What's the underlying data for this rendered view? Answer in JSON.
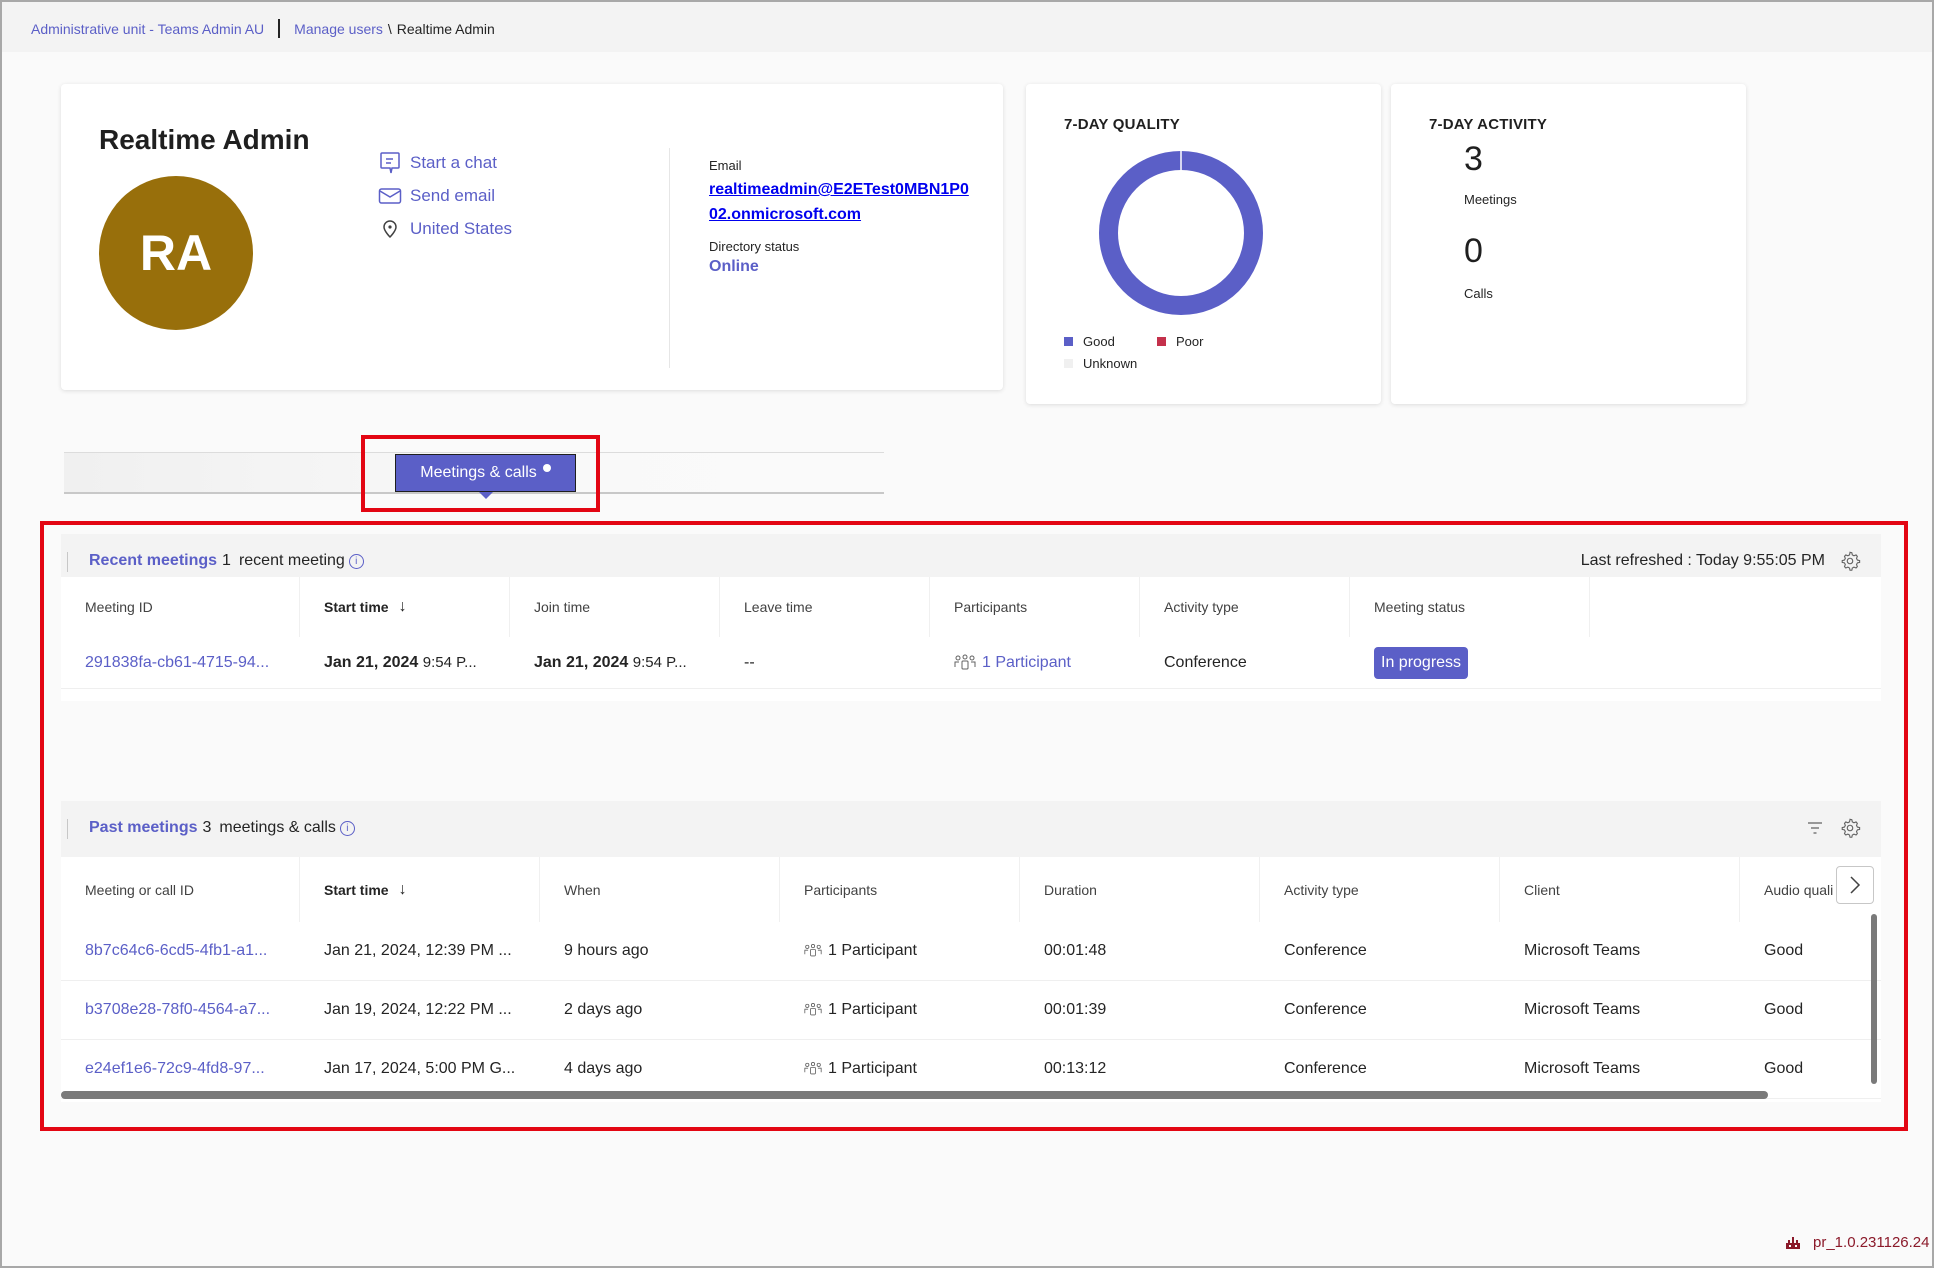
{
  "breadcrumb": {
    "admin_unit": "Administrative unit - Teams Admin AU",
    "manage_users": "Manage users",
    "separator": "\\",
    "current": "Realtime Admin"
  },
  "profile": {
    "name": "Realtime Admin",
    "initials": "RA",
    "avatar_color": "#986f0b",
    "actions": [
      {
        "icon": "chat-icon",
        "label": "Start a chat"
      },
      {
        "icon": "mail-icon",
        "label": "Send email"
      },
      {
        "icon": "location-icon",
        "label": "United States"
      }
    ],
    "email_label": "Email",
    "email": "realtimeadmin@E2ETest0MBN1P002.onmicrosoft.com",
    "directory_status_label": "Directory status",
    "directory_status": "Online"
  },
  "quality": {
    "title": "7-DAY QUALITY",
    "chart_data": {
      "type": "pie",
      "title": "7-DAY QUALITY",
      "categories": [
        "Good",
        "Poor",
        "Unknown"
      ],
      "values": [
        100,
        0,
        0
      ],
      "colors": [
        "#5b5fc7",
        "#c4314b",
        "#f0f0f0"
      ],
      "legend": "bottom"
    },
    "legend": [
      {
        "label": "Good",
        "color": "#5b5fc7"
      },
      {
        "label": "Poor",
        "color": "#c4314b"
      },
      {
        "label": "Unknown",
        "color": "#f0f0f0"
      }
    ]
  },
  "activity": {
    "title": "7-DAY ACTIVITY",
    "meetings_count": "3",
    "meetings_label": "Meetings",
    "calls_count": "0",
    "calls_label": "Calls"
  },
  "tabs": {
    "active": "Meetings & calls"
  },
  "recent": {
    "title": "Recent meetings",
    "count": "1",
    "count_label": "recent meeting",
    "last_refreshed": "Last refreshed : Today 9:55:05 PM",
    "columns": [
      "Meeting ID",
      "Start time",
      "Join time",
      "Leave time",
      "Participants",
      "Activity type",
      "Meeting status"
    ],
    "sort_arrow": "↓",
    "rows": [
      {
        "id": "291838fa-cb61-4715-94...",
        "start_date": "Jan 21, 2024",
        "start_time": "9:54 P...",
        "join_date": "Jan 21, 2024",
        "join_time": "9:54 P...",
        "leave": "--",
        "participants": "1 Participant",
        "activity": "Conference",
        "status": "In progress"
      }
    ]
  },
  "past": {
    "title": "Past meetings",
    "count": "3",
    "count_label": "meetings & calls",
    "columns": [
      "Meeting or call ID",
      "Start time",
      "When",
      "Participants",
      "Duration",
      "Activity type",
      "Client",
      "Audio quali"
    ],
    "sort_arrow": "↓",
    "rows": [
      {
        "id": "8b7c64c6-6cd5-4fb1-a1...",
        "start": "Jan 21, 2024, 12:39 PM ...",
        "when": "9 hours ago",
        "participants": "1 Participant",
        "duration": "00:01:48",
        "activity": "Conference",
        "client": "Microsoft Teams",
        "audio": "Good"
      },
      {
        "id": "b3708e28-78f0-4564-a7...",
        "start": "Jan 19, 2024, 12:22 PM ...",
        "when": "2 days ago",
        "participants": "1 Participant",
        "duration": "00:01:39",
        "activity": "Conference",
        "client": "Microsoft Teams",
        "audio": "Good"
      },
      {
        "id": "e24ef1e6-72c9-4fd8-97...",
        "start": "Jan 17, 2024, 5:00 PM G...",
        "when": "4 days ago",
        "participants": "1 Participant",
        "duration": "00:13:12",
        "activity": "Conference",
        "client": "Microsoft Teams",
        "audio": "Good"
      }
    ]
  },
  "footer": {
    "version": "pr_1.0.231126.24"
  },
  "colors": {
    "accent": "#5b5fc7",
    "highlight": "#e30613"
  }
}
